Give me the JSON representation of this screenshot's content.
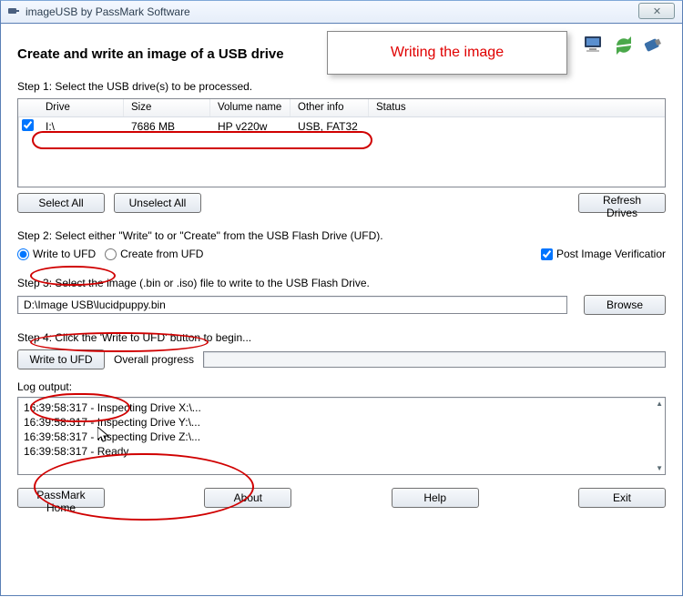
{
  "titlebar": {
    "title": "imageUSB by PassMark Software"
  },
  "annotation": "Writing the image",
  "heading": "Create and write an image of a USB drive",
  "step1": {
    "label": "Step 1: Select the USB drive(s) to be processed.",
    "columns": {
      "drive": "Drive",
      "size": "Size",
      "volume": "Volume name",
      "other": "Other info",
      "status": "Status"
    },
    "rows": [
      {
        "checked": true,
        "drive": "I:\\",
        "size": "7686 MB",
        "volume": "HP v220w",
        "other": "USB, FAT32",
        "status": ""
      }
    ],
    "buttons": {
      "select_all": "Select All",
      "unselect_all": "Unselect All",
      "refresh": "Refresh Drives"
    }
  },
  "step2": {
    "label": "Step 2: Select either \"Write\" to or \"Create\" from the USB Flash Drive (UFD).",
    "write": "Write to UFD",
    "create": "Create from UFD",
    "post_verify": "Post Image Verificatior"
  },
  "step3": {
    "label": "Step 3: Select the image (.bin or .iso) file to write to the USB Flash Drive.",
    "path": "D:\\Image USB\\lucidpuppy.bin",
    "browse": "Browse"
  },
  "step4": {
    "label": "Step 4: Click the 'Write to UFD' button to begin...",
    "button": "Write to UFD",
    "overall": "Overall progress"
  },
  "log": {
    "label": "Log output:",
    "lines": [
      "16:39:58:317 - Inspecting Drive X:\\...",
      "16:39:58:317 - Inspecting Drive Y:\\...",
      "16:39:58:317 - Inspecting Drive Z:\\...",
      "16:39:58:317 - Ready..."
    ]
  },
  "footer": {
    "home": "PassMark Home",
    "about": "About",
    "help": "Help",
    "exit": "Exit"
  }
}
